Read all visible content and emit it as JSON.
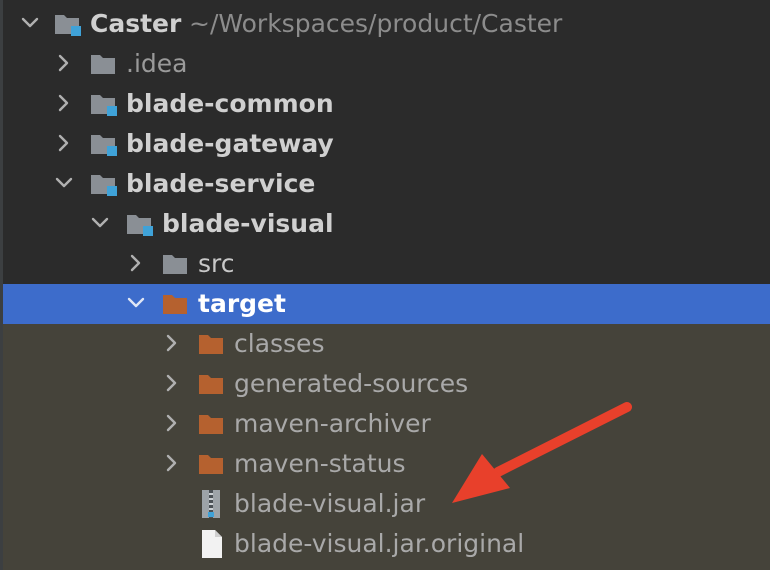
{
  "tree": {
    "root": {
      "label": "Caster",
      "path": "~/Workspaces/product/Caster"
    },
    "items": [
      {
        "label": ".idea"
      },
      {
        "label": "blade-common"
      },
      {
        "label": "blade-gateway"
      },
      {
        "label": "blade-service"
      },
      {
        "label": "blade-visual"
      },
      {
        "label": "src"
      },
      {
        "label": "target"
      },
      {
        "label": "classes"
      },
      {
        "label": "generated-sources"
      },
      {
        "label": "maven-archiver"
      },
      {
        "label": "maven-status"
      },
      {
        "label": "blade-visual.jar"
      },
      {
        "label": "blade-visual.jar.original"
      }
    ]
  },
  "colors": {
    "background": "#2b2b2b",
    "selection": "#3d6ccb",
    "excluded_background": "#45433a",
    "folder_gray": "#8a8f95",
    "folder_orange": "#b5612f",
    "module_marker": "#3fa2d8",
    "annotation_arrow": "#e8402b"
  }
}
